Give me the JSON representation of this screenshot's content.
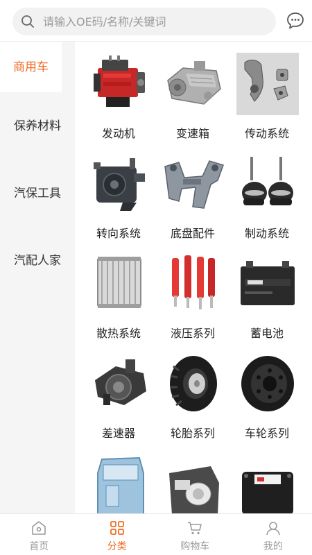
{
  "search": {
    "placeholder": "请输入OE码/名称/关键词"
  },
  "sidebar": {
    "items": [
      {
        "label": "商用车",
        "active": true
      },
      {
        "label": "保养材料",
        "active": false
      },
      {
        "label": "汽保工具",
        "active": false
      },
      {
        "label": "汽配人家",
        "active": false
      }
    ]
  },
  "categories": [
    {
      "label": "发动机",
      "icon": "engine-icon"
    },
    {
      "label": "变速箱",
      "icon": "gearbox-icon"
    },
    {
      "label": "传动系统",
      "icon": "driveshaft-yoke-icon"
    },
    {
      "label": "转向系统",
      "icon": "steering-gear-icon"
    },
    {
      "label": "底盘配件",
      "icon": "chassis-bracket-icon"
    },
    {
      "label": "制动系统",
      "icon": "brake-chamber-icon"
    },
    {
      "label": "散热系统",
      "icon": "radiator-icon"
    },
    {
      "label": "液压系列",
      "icon": "hydraulic-cylinder-icon"
    },
    {
      "label": "蓄电池",
      "icon": "battery-icon"
    },
    {
      "label": "差速器",
      "icon": "differential-icon"
    },
    {
      "label": "轮胎系列",
      "icon": "tire-icon"
    },
    {
      "label": "车轮系列",
      "icon": "wheel-rim-icon"
    },
    {
      "label": "",
      "icon": "truck-cab-icon"
    },
    {
      "label": "",
      "icon": "headlamp-icon"
    },
    {
      "label": "",
      "icon": "control-box-icon"
    }
  ],
  "bottom_nav": [
    {
      "label": "首页",
      "icon": "home-icon",
      "active": false
    },
    {
      "label": "分类",
      "icon": "category-grid-icon",
      "active": true
    },
    {
      "label": "购物车",
      "icon": "cart-icon",
      "active": false
    },
    {
      "label": "我的",
      "icon": "profile-icon",
      "active": false
    }
  ],
  "colors": {
    "accent": "#ef6b21",
    "sidebar_bg": "#f5f5f5",
    "inactive": "#9a9a9a"
  }
}
